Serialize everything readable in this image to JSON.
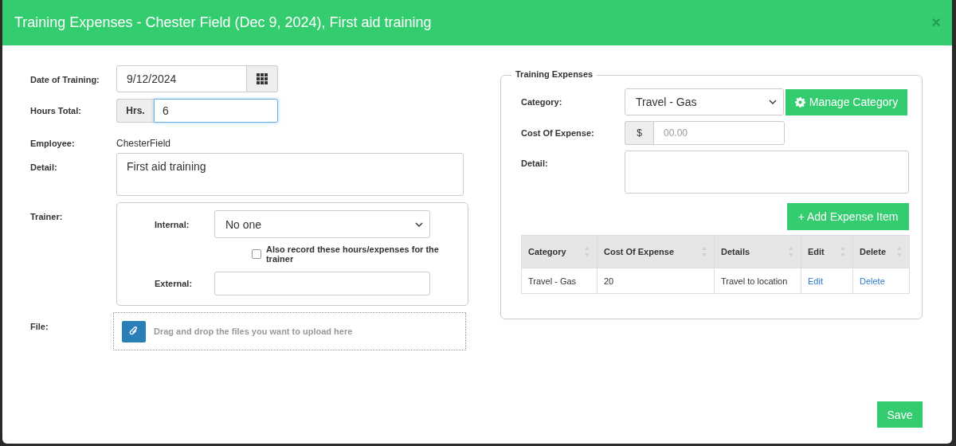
{
  "window": {
    "title": "Training Expenses - Chester Field (Dec 9, 2024), First aid training",
    "close": "×"
  },
  "form": {
    "date": {
      "label": "Date of Training:",
      "value": "9/12/2024"
    },
    "hours": {
      "label": "Hours Total:",
      "addon": "Hrs.",
      "value": "6",
      "focused": true
    },
    "employee": {
      "label": "Employee:",
      "value": "ChesterField"
    },
    "detail": {
      "label": "Detail:",
      "value": "First aid training"
    },
    "trainer": {
      "label": "Trainer:",
      "internal_label": "Internal:",
      "internal_value": "No one",
      "also_record": {
        "label": "Also record these hours/expenses for the trainer",
        "checked": false
      },
      "external_label": "External:"
    },
    "file": {
      "label": "File:",
      "hint": "Drag and drop the files you want to upload here"
    }
  },
  "expenses": {
    "legend": "Training Expenses",
    "category": {
      "label": "Category:",
      "value": "Travel - Gas"
    },
    "manage_button": "Manage Category",
    "cost": {
      "label": "Cost Of Expense:",
      "addon": "$",
      "placeholder": "00.00"
    },
    "detail": {
      "label": "Detail:"
    },
    "add_button": "+ Add Expense Item",
    "table": {
      "columns": [
        "Category",
        "Cost Of Expense",
        "Details",
        "Edit",
        "Delete"
      ],
      "rows": [
        {
          "category": "Travel - Gas",
          "cost": "20",
          "details": "Travel to location",
          "edit": "Edit",
          "delete": "Delete"
        }
      ]
    }
  },
  "save_button": "Save"
}
